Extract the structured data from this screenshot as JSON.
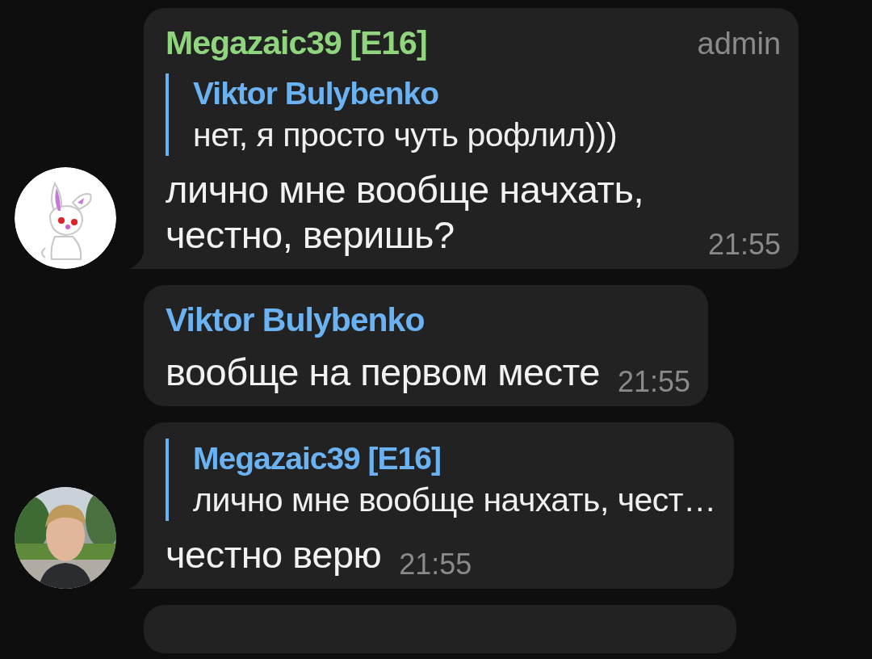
{
  "messages": [
    {
      "kind": "message",
      "avatar": {
        "kind": "drawing"
      },
      "sender": {
        "name": "Megazaic39 [E16]",
        "color": "#8fd57d"
      },
      "role": "admin",
      "reply": {
        "author": "Viktor Bulybenko",
        "text": "нет, я просто чуть рофлил)))"
      },
      "text": "лично мне вообще начхать, честно, веришь?",
      "time": "21:55",
      "tail": true
    },
    {
      "kind": "message",
      "sender": {
        "name": "Viktor Bulybenko",
        "color": "#6ab2f2"
      },
      "text": "вообще на первом месте",
      "time": "21:55",
      "tail": false
    },
    {
      "kind": "message",
      "reply": {
        "author": "Megazaic39 [E16]",
        "text": "лично мне вообще начхать, чест…"
      },
      "text": "честно верю",
      "time": "21:55",
      "tail": true
    },
    {
      "kind": "clipped"
    }
  ]
}
